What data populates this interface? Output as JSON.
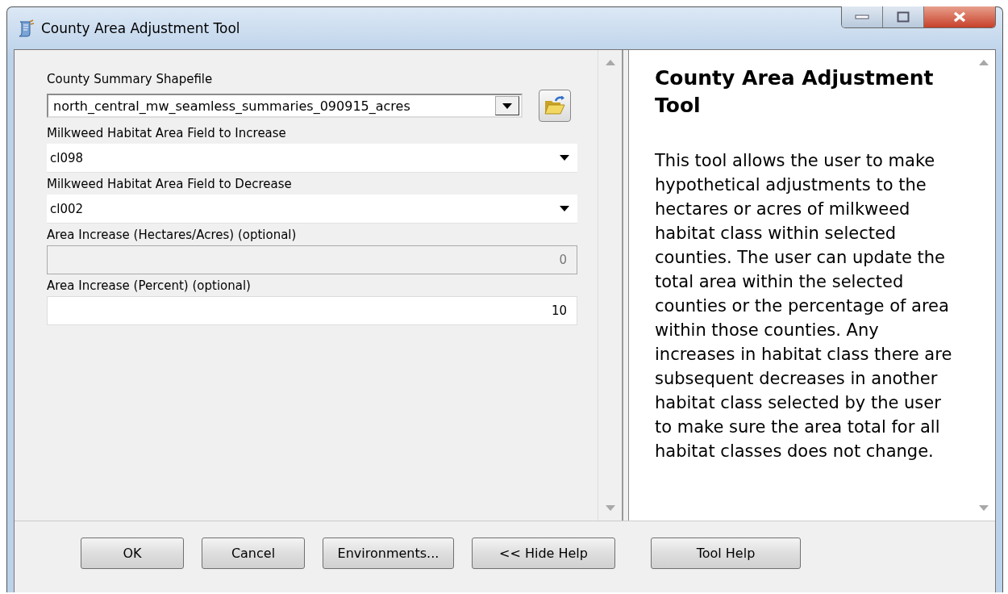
{
  "window": {
    "title": "County Area Adjustment Tool"
  },
  "parameters": [
    {
      "kind": "combo",
      "label": "County Summary Shapefile",
      "value": "north_central_mw_seamless_summaries_090915_acres",
      "disabled": false
    },
    {
      "kind": "dropdown",
      "label": "Milkweed Habitat Area Field to Increase",
      "value": "cl098",
      "disabled": false
    },
    {
      "kind": "dropdown",
      "label": "Milkweed Habitat Area Field to Decrease",
      "value": "cl002",
      "disabled": false
    },
    {
      "kind": "number",
      "label": "Area Increase (Hectares/Acres) (optional)",
      "value": "0",
      "disabled": true
    },
    {
      "kind": "number",
      "label": "Area Increase (Percent) (optional)",
      "value": "10",
      "disabled": false
    }
  ],
  "help": {
    "title": "County Area Adjustment Tool",
    "text": "This tool allows the user to make hypothetical adjustments to the hectares or acres of milkweed habitat class within selected counties. The user can update the total area within the selected counties or the percentage of area within those counties. Any increases in habitat class there are subsequent decreases in another habitat class selected by the user to make sure the area total for all habitat classes does not change."
  },
  "buttons": [
    "OK",
    "Cancel",
    "Environments...",
    "<< Hide Help",
    "Tool Help"
  ]
}
